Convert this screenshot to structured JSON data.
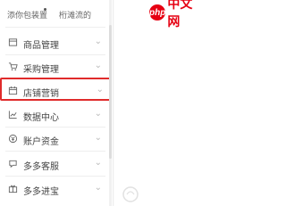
{
  "header": {
    "item_left": "添你包装置",
    "item_right": "桁滩流的"
  },
  "logo": {
    "mark": "php",
    "text": "中文网"
  },
  "menu": [
    {
      "label": "商品管理",
      "icon": "folder-icon",
      "active": false
    },
    {
      "label": "采购管理",
      "icon": "cart-icon",
      "active": false
    },
    {
      "label": "店铺营销",
      "icon": "calendar-icon",
      "active": true
    },
    {
      "label": "数据中心",
      "icon": "chart-icon",
      "active": false
    },
    {
      "label": "账户资金",
      "icon": "wallet-icon",
      "active": false
    },
    {
      "label": "多多客服",
      "icon": "chat-icon",
      "active": false
    },
    {
      "label": "多多进宝",
      "icon": "gift-icon",
      "active": false
    }
  ],
  "colors": {
    "highlight": "#e02b2b",
    "logo": "#e60012"
  }
}
